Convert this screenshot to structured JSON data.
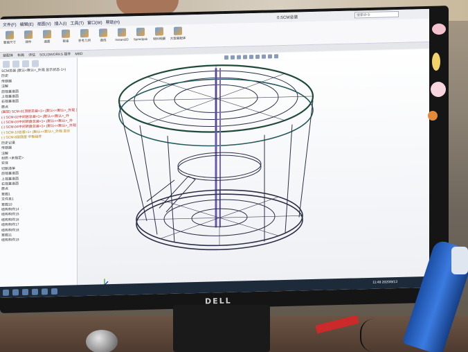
{
  "window": {
    "document_title": "0.SCM总装",
    "search_placeholder": "搜索命令"
  },
  "menu": [
    "文件(F)",
    "编辑(E)",
    "视图(V)",
    "插入(I)",
    "工具(T)",
    "窗口(W)",
    "帮助(H)"
  ],
  "ribbon": [
    {
      "label": "智能尺寸"
    },
    {
      "label": "焊件"
    },
    {
      "label": "曲面"
    },
    {
      "label": "钣金"
    },
    {
      "label": "参考几何"
    },
    {
      "label": "曲线"
    },
    {
      "label": "Instant3D"
    },
    {
      "label": "Speedpak"
    },
    {
      "label": "材料明细"
    },
    {
      "label": "大型装配体"
    }
  ],
  "tabs": [
    "装配体",
    "布局",
    "评估",
    "SOLIDWORKS 插件",
    "MBD"
  ],
  "tree": {
    "items": [
      {
        "text": "SCM总装 (默认<默认>_外观 显示状态-1>)",
        "kind": "normal"
      },
      {
        "text": "历史",
        "kind": "normal"
      },
      {
        "text": "传感器",
        "kind": "normal"
      },
      {
        "text": "注解",
        "kind": "normal"
      },
      {
        "text": "前视基准面",
        "kind": "normal"
      },
      {
        "text": "上视基准面",
        "kind": "normal"
      },
      {
        "text": "右视基准面",
        "kind": "normal"
      },
      {
        "text": "原点",
        "kind": "normal"
      },
      {
        "text": "(固定) SCM-01顶层总装<1> (默认<<默认>_外观 显示",
        "kind": "err"
      },
      {
        "text": "(-) SCM-02中间层总装<1> (默认<<默认>_外",
        "kind": "err"
      },
      {
        "text": "(-) SCM-03中间转盘总装<1> (默认<<默认>_外",
        "kind": "err"
      },
      {
        "text": "(-) SCM-04中间转盘总装<1> (默认<<默认>_外观",
        "kind": "err"
      },
      {
        "text": "(-) SCM-10总装<1> (默认<<默认>_外观 显示",
        "kind": "w"
      },
      {
        "text": "(-) SCM-8层底座 中板组件",
        "kind": "w"
      },
      {
        "text": "历史记录",
        "kind": "normal"
      },
      {
        "text": "传感器",
        "kind": "normal"
      },
      {
        "text": "注解",
        "kind": "normal"
      },
      {
        "text": "材质 <未指定>",
        "kind": "normal"
      },
      {
        "text": "实体",
        "kind": "normal"
      },
      {
        "text": "切割清单",
        "kind": "normal"
      },
      {
        "text": "前视基准面",
        "kind": "normal"
      },
      {
        "text": "上视基准面",
        "kind": "normal"
      },
      {
        "text": "右视基准面",
        "kind": "normal"
      },
      {
        "text": "原点",
        "kind": "normal"
      },
      {
        "text": "草图1",
        "kind": "normal"
      },
      {
        "text": "文件夹1",
        "kind": "normal"
      },
      {
        "text": "草图10",
        "kind": "normal"
      },
      {
        "text": "结构构件14",
        "kind": "normal"
      },
      {
        "text": "结构构件15",
        "kind": "normal"
      },
      {
        "text": "结构构件16",
        "kind": "normal"
      },
      {
        "text": "结构构件17",
        "kind": "normal"
      },
      {
        "text": "结构构件18",
        "kind": "normal"
      },
      {
        "text": "草图11",
        "kind": "normal"
      },
      {
        "text": "结构构件19",
        "kind": "normal"
      }
    ]
  },
  "status": {
    "time": "11:48",
    "date": "2020/8/13"
  },
  "brand": "DELL"
}
